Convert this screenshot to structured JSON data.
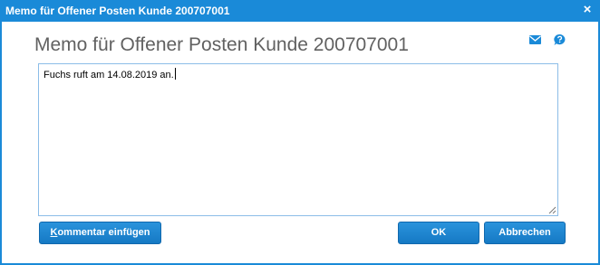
{
  "window": {
    "title": "Memo für Offener Posten Kunde 200707001",
    "close_symbol": "×",
    "accent_color": "#1a8ad8"
  },
  "header": {
    "heading": "Memo für Offener Posten Kunde 200707001",
    "icons": [
      "mail-icon",
      "help-icon"
    ]
  },
  "memo": {
    "value": "Fuchs ruft am 14.08.2019 an."
  },
  "buttons": {
    "comment_accel": "K",
    "comment_rest": "ommentar einfügen",
    "ok": "OK",
    "cancel": "Abbrechen"
  }
}
